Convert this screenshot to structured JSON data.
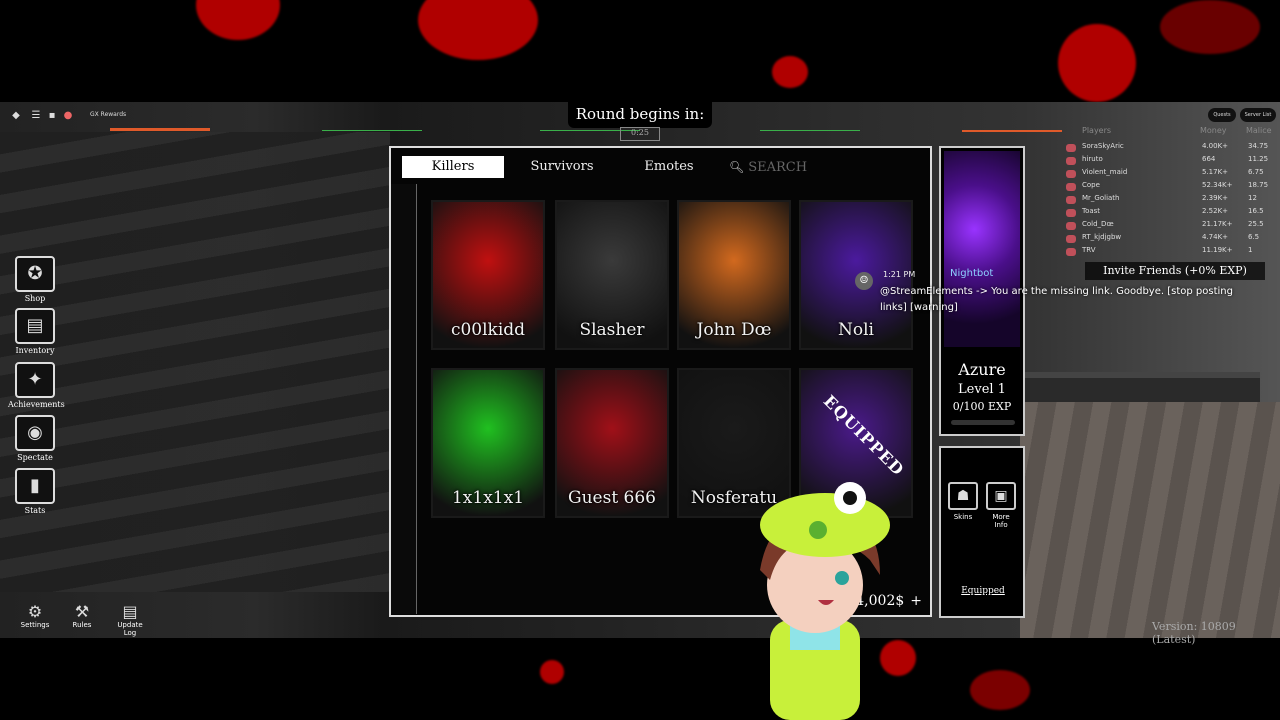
{
  "topbar": {
    "gx_rewards": "GX Rewards",
    "round_label": "Round begins in:",
    "round_value": "0:25",
    "quests": "Quests",
    "server_list": "Server List"
  },
  "side_menu": {
    "shop": "Shop",
    "inventory": "Inventory",
    "achievements": "Achievements",
    "spectate": "Spectate",
    "stats": "Stats"
  },
  "bottom_menu": {
    "settings": "Settings",
    "rules": "Rules",
    "update_log": "Update Log"
  },
  "tabs": {
    "killers": "Killers",
    "survivors": "Survivors",
    "emotes": "Emotes",
    "search_placeholder": "SEARCH"
  },
  "killers": [
    {
      "name": "c00lkidd",
      "color": "#c01010"
    },
    {
      "name": "Slasher",
      "color": "#3a3a3a"
    },
    {
      "name": "John Dœ",
      "color": "#d2691e"
    },
    {
      "name": "Noli",
      "color": "#4b1a9e"
    },
    {
      "name": "1x1x1x1",
      "color": "#20c020"
    },
    {
      "name": "Guest 666",
      "color": "#a01018"
    },
    {
      "name": "Nosferatu",
      "color": "#1a1a1a"
    },
    {
      "name": "",
      "color": "#4a1a8a"
    }
  ],
  "equipped_stamp": "EQUIPPED",
  "money": "4,002$",
  "money_plus": "+",
  "info": {
    "name": "Azure",
    "level": "Level 1",
    "exp": "0/100 EXP",
    "exp_progress": 0
  },
  "actions": {
    "skins": "Skins",
    "more_info": "More Info",
    "equipped": "Equipped"
  },
  "leaderboard": {
    "col_players": "Players",
    "col_money": "Money",
    "col_malice": "Malice",
    "rows": [
      {
        "player": "SoraSkyAric",
        "money": "4.00K+",
        "malice": "34.75"
      },
      {
        "player": "hiruto",
        "money": "664",
        "malice": "11.25"
      },
      {
        "player": "Violent_maid",
        "money": "5.17K+",
        "malice": "6.75"
      },
      {
        "player": "Cope",
        "money": "52.34K+",
        "malice": "18.75"
      },
      {
        "player": "Mr_Goliath",
        "money": "2.39K+",
        "malice": "12"
      },
      {
        "player": "Toast",
        "money": "2.52K+",
        "malice": "16.5"
      },
      {
        "player": "Cold_Dœ",
        "money": "21.17K+",
        "malice": "25.5"
      },
      {
        "player": "RT_kjdjgbw",
        "money": "4.74K+",
        "malice": "6.5"
      },
      {
        "player": "TRV",
        "money": "11.19K+",
        "malice": "1"
      }
    ],
    "invite": "Invite Friends (+0% EXP)"
  },
  "chat": {
    "time": "1:21 PM",
    "user": "Nightbot",
    "message": "@StreamElements -> You are the missing link. Goodbye. [stop posting links] [warning]"
  },
  "version": "Version: 10809 (Latest)",
  "colors": {
    "panel_border": "#dddddd",
    "tab_active_bg": "#ffffff",
    "leaderboard_dot": "#c0505a",
    "chat_user": "#8ed2ff"
  }
}
